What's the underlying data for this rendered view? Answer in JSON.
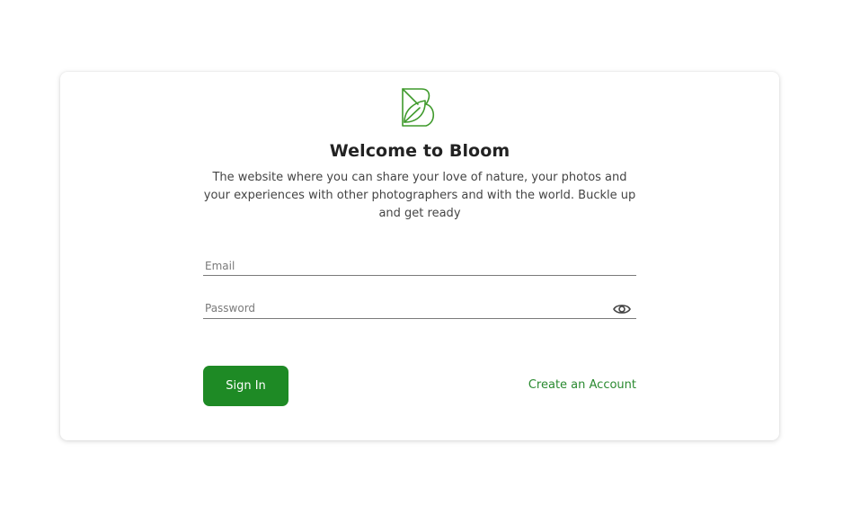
{
  "brand": {
    "logo_icon": "bloom-leaf-b-logo",
    "accent_color": "#1e8a25"
  },
  "header": {
    "title": "Welcome to Bloom",
    "description": "The website where you can share your love of nature, your photos and your experiences with other photographers and with the world. Buckle up and get ready"
  },
  "form": {
    "email": {
      "placeholder": "Email",
      "value": ""
    },
    "password": {
      "placeholder": "Password",
      "value": "",
      "toggle_icon": "eye-icon"
    },
    "sign_in_label": "Sign In",
    "create_account_label": "Create an Account"
  }
}
